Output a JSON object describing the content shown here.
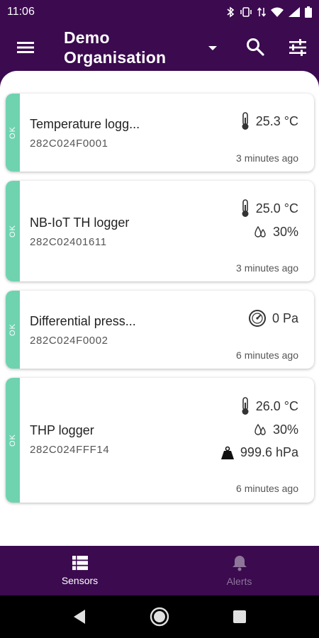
{
  "status_bar": {
    "time": "11:06",
    "icons": [
      "bluetooth-icon",
      "vibrate-icon",
      "data-arrows-icon",
      "wifi-icon",
      "signal-icon",
      "battery-icon"
    ]
  },
  "app_bar": {
    "org_title_line1": "Demo",
    "org_title_line2": "Organisation",
    "icons": [
      "menu-icon",
      "dropdown-icon",
      "search-icon",
      "filter-icon"
    ]
  },
  "colors": {
    "primary": "#3b0a4f",
    "ok": "#6fd3b0",
    "inactive_nav": "#8e7599"
  },
  "sensors": [
    {
      "status": "OK",
      "name": "Temperature logg...",
      "id": "282C024F0001",
      "readings": [
        {
          "icon": "thermometer-icon",
          "value": "25.3 °C"
        }
      ],
      "time": "3 minutes ago"
    },
    {
      "status": "OK",
      "name": "NB-IoT TH logger",
      "id": "282C02401611",
      "readings": [
        {
          "icon": "thermometer-icon",
          "value": "25.0 °C"
        },
        {
          "icon": "humidity-icon",
          "value": "30%"
        }
      ],
      "time": "3 minutes ago"
    },
    {
      "status": "OK",
      "name": "Differential press...",
      "id": "282C024F0002",
      "readings": [
        {
          "icon": "pressure-gauge-icon",
          "value": "0 Pa"
        }
      ],
      "time": "6 minutes ago"
    },
    {
      "status": "OK",
      "name": "THP logger",
      "id": "282C024FFF14",
      "readings": [
        {
          "icon": "thermometer-icon",
          "value": "26.0 °C"
        },
        {
          "icon": "humidity-icon",
          "value": "30%"
        },
        {
          "icon": "weight-icon",
          "value": "999.6 hPa"
        }
      ],
      "time": "6 minutes ago"
    }
  ],
  "bottom_nav": {
    "sensors_label": "Sensors",
    "alerts_label": "Alerts",
    "active": "Sensors"
  },
  "system_nav": [
    "back-icon",
    "home-icon",
    "recents-icon"
  ]
}
